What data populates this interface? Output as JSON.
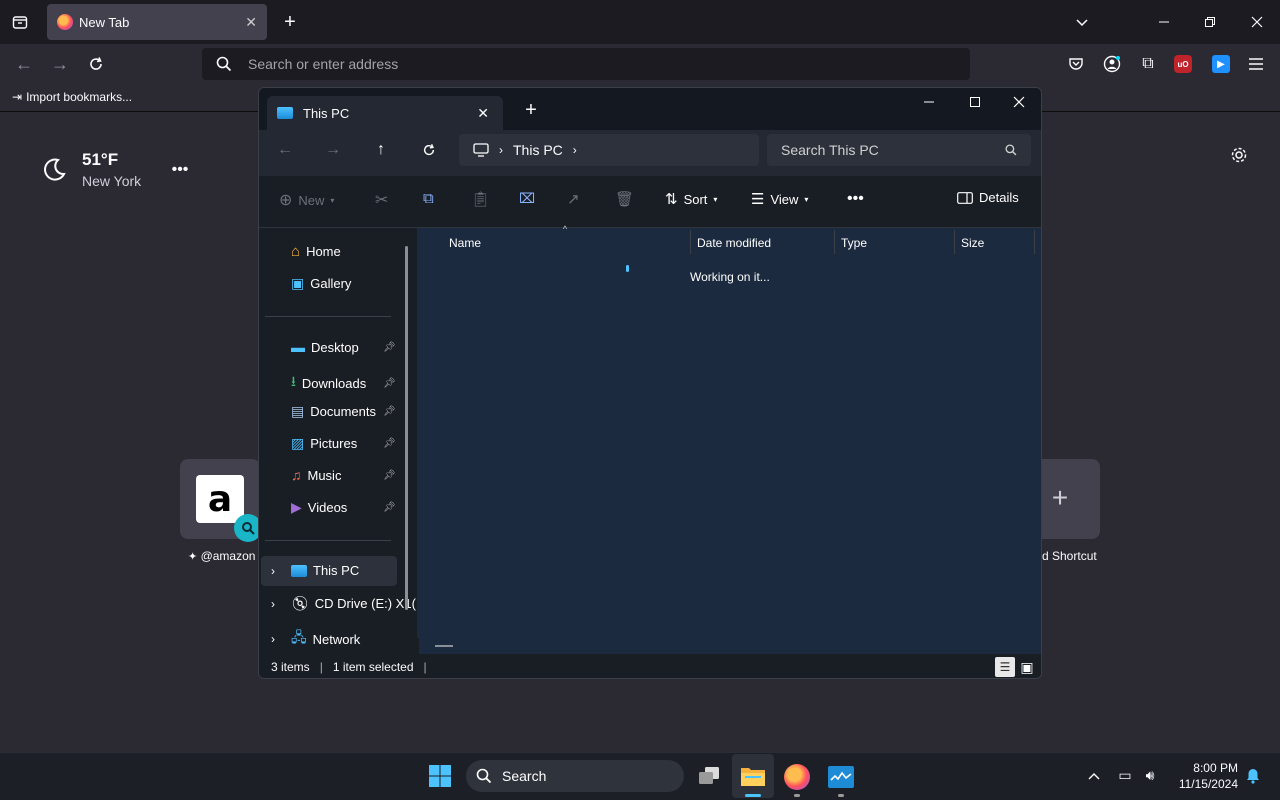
{
  "browser": {
    "tab_title": "New Tab",
    "address_placeholder": "Search or enter address",
    "bookmarks_import": "Import bookmarks..."
  },
  "newtab": {
    "weather_temp": "51°F",
    "weather_city": "New York",
    "shortcut_amazon": "@amazon",
    "shortcut_add": "d Shortcut"
  },
  "explorer": {
    "tab_title": "This PC",
    "breadcrumb": "This PC",
    "search_placeholder": "Search This PC",
    "toolbar": {
      "new": "New",
      "sort": "Sort",
      "view": "View",
      "details": "Details"
    },
    "nav": {
      "home": "Home",
      "gallery": "Gallery",
      "desktop": "Desktop",
      "downloads": "Downloads",
      "documents": "Documents",
      "pictures": "Pictures",
      "music": "Music",
      "videos": "Videos",
      "this_pc": "This PC",
      "cd_drive": "CD Drive (E:) X1(",
      "network": "Network"
    },
    "columns": [
      "Name",
      "Date modified",
      "Type",
      "Size"
    ],
    "loading_text": "Working on it...",
    "status_items": "3 items",
    "status_selected": "1 item selected"
  },
  "taskbar": {
    "search": "Search",
    "time": "8:00 PM",
    "date": "11/15/2024"
  }
}
